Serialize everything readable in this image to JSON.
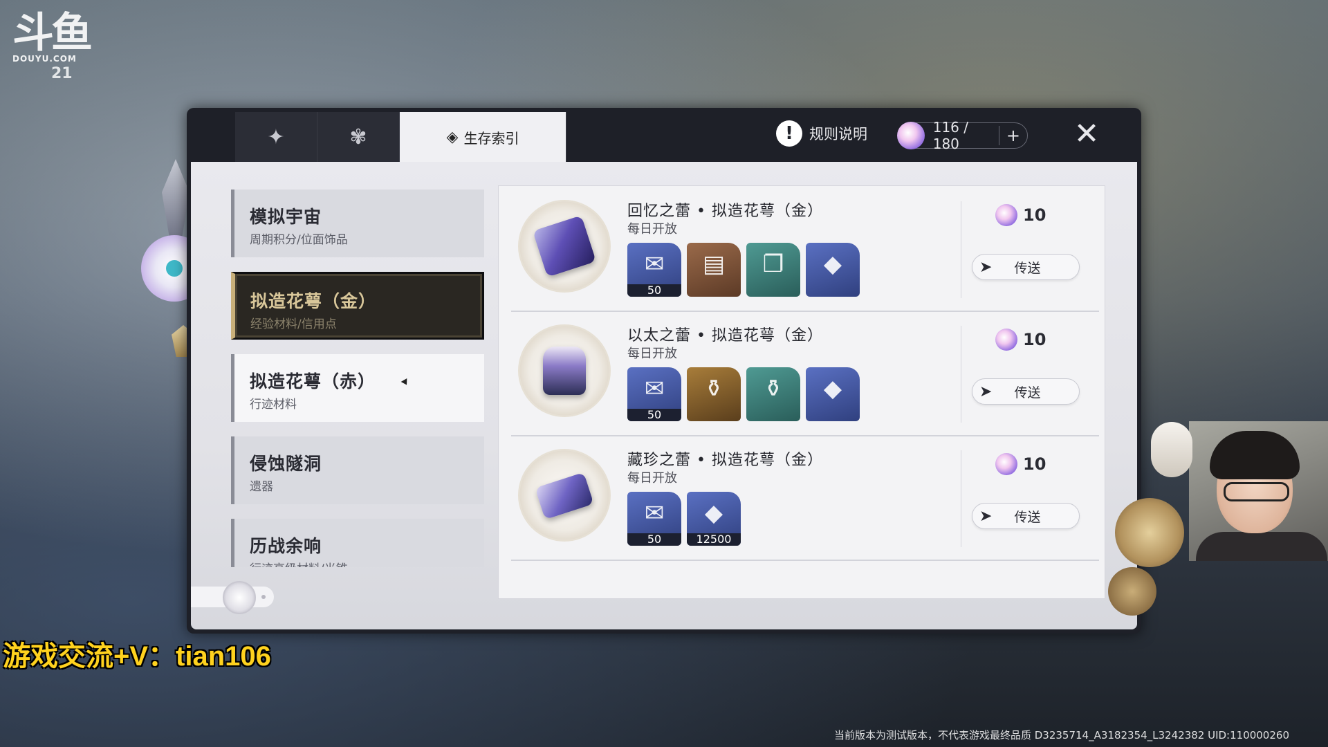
{
  "overlay": {
    "platform_logo": "斗鱼",
    "platform_domain": "DOUYU.COM",
    "room_number": "21",
    "promo_text": "游戏交流+V：tian106",
    "watermark": "当前版本为测试版本，不代表游戏最终品质  D3235714_A3182354_L3242382   UID:110000260"
  },
  "header": {
    "tabs": [
      {
        "icon": "rune-icon",
        "glyph": "✦",
        "label": ""
      },
      {
        "icon": "flower-icon",
        "glyph": "✾",
        "label": ""
      },
      {
        "icon": "compass-icon",
        "glyph": "◈",
        "label": "生存索引"
      }
    ],
    "rules_label": "规则说明",
    "rules_glyph": "!",
    "stamina": "116 / 180",
    "stamina_add": "+",
    "close_glyph": "✕"
  },
  "categories": [
    {
      "name": "模拟宇宙",
      "desc": "周期积分/位面饰品"
    },
    {
      "name": "拟造花萼（金）",
      "desc": "经验材料/信用点"
    },
    {
      "name": "拟造花萼（赤）",
      "desc": "行迹材料"
    },
    {
      "name": "侵蚀隧洞",
      "desc": "遗器"
    },
    {
      "name": "历战余响",
      "desc": "行迹高级材料/光锥"
    }
  ],
  "selected_category": "拟造花萼（金）",
  "domains": [
    {
      "title": "回忆之蕾 • 拟造花萼（金）",
      "availability": "每日开放",
      "cost": "10",
      "teleport_label": "传送",
      "rewards": [
        {
          "icon": "trailblaze-exp-icon",
          "glyph": "✉",
          "count": "50",
          "color": "blue"
        },
        {
          "icon": "adventure-log-icon",
          "glyph": "▤",
          "count": "",
          "color": "brown"
        },
        {
          "icon": "travel-encounters-icon",
          "glyph": "❐",
          "count": "",
          "color": "teal"
        },
        {
          "icon": "credit-card-icon",
          "glyph": "◆",
          "count": "",
          "color": "blue"
        }
      ]
    },
    {
      "title": "以太之蕾 • 拟造花萼（金）",
      "availability": "每日开放",
      "cost": "10",
      "teleport_label": "传送",
      "rewards": [
        {
          "icon": "trailblaze-exp-icon",
          "glyph": "✉",
          "count": "50",
          "color": "blue"
        },
        {
          "icon": "refined-aether-icon",
          "glyph": "⚱",
          "count": "",
          "color": "gold"
        },
        {
          "icon": "condensed-aether-icon",
          "glyph": "⚱",
          "count": "",
          "color": "teal"
        },
        {
          "icon": "credit-card-icon",
          "glyph": "◆",
          "count": "",
          "color": "blue"
        }
      ]
    },
    {
      "title": "藏珍之蕾 • 拟造花萼（金）",
      "availability": "每日开放",
      "cost": "10",
      "teleport_label": "传送",
      "rewards": [
        {
          "icon": "trailblaze-exp-icon",
          "glyph": "✉",
          "count": "50",
          "color": "blue"
        },
        {
          "icon": "credit-card-icon",
          "glyph": "◆",
          "count": "12500",
          "color": "blue"
        }
      ]
    }
  ]
}
